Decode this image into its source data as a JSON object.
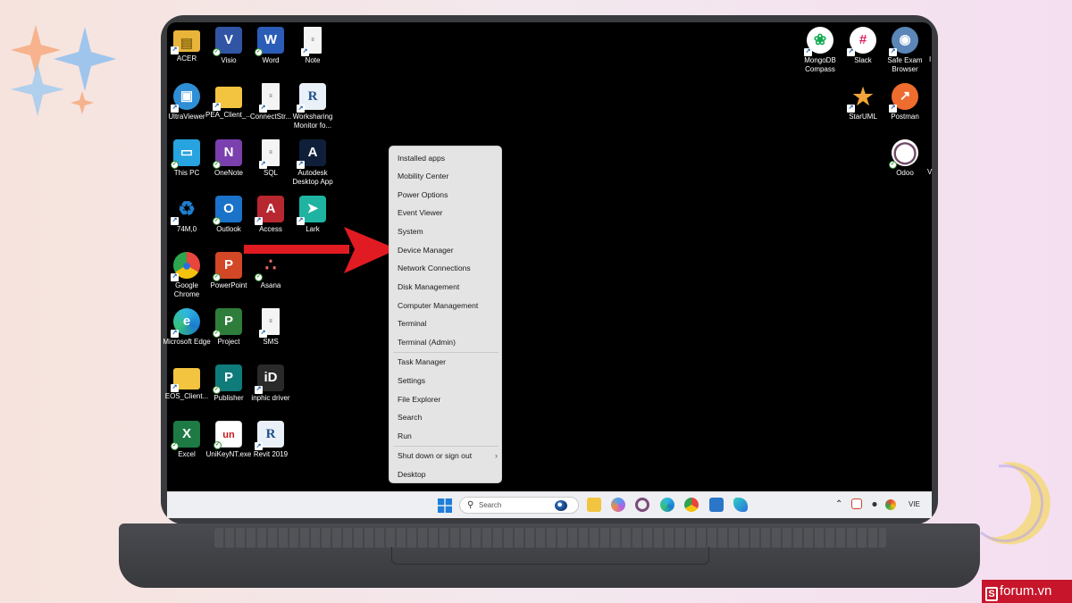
{
  "desktop": {
    "icons": [
      {
        "label": "ACER",
        "color": "#e8b43a",
        "glyph": "▤",
        "kind": "folder"
      },
      {
        "label": "Visio",
        "color": "#3155a4",
        "glyph": "V"
      },
      {
        "label": "Word",
        "color": "#2b5db8",
        "glyph": "W"
      },
      {
        "label": "Note",
        "color": "#f4f4f4",
        "glyph": "≡",
        "kind": "doc"
      },
      {
        "label": "UltraViewer",
        "color": "#2f8fd6",
        "glyph": "▣"
      },
      {
        "label": "PEA_Client_...",
        "color": "#f2c43f",
        "glyph": "",
        "kind": "folder"
      },
      {
        "label": "ConnectStr...",
        "color": "#f4f4f4",
        "glyph": "≡",
        "kind": "doc"
      },
      {
        "label": "Worksharing Monitor fo...",
        "color": "#eaf0f7",
        "glyph": "R",
        "kind": "revit"
      },
      {
        "label": "This PC",
        "color": "#27a3e0",
        "glyph": "▭"
      },
      {
        "label": "OneNote",
        "color": "#7b3fae",
        "glyph": "N"
      },
      {
        "label": "SQL",
        "color": "#f4f4f4",
        "glyph": "≡",
        "kind": "doc"
      },
      {
        "label": "Autodesk Desktop App",
        "color": "#0f1f3a",
        "glyph": "A"
      },
      {
        "label": "74M,0",
        "color": "#dfe8f0",
        "glyph": "♻",
        "kind": "bin"
      },
      {
        "label": "Outlook",
        "color": "#1a73c8",
        "glyph": "O"
      },
      {
        "label": "Access",
        "color": "#b7272f",
        "glyph": "A"
      },
      {
        "label": "Lark",
        "color": "#1fb3a2",
        "glyph": "➤"
      },
      {
        "label": "Google Chrome",
        "color": "#e6b321",
        "glyph": "●",
        "kind": "chrome"
      },
      {
        "label": "PowerPoint",
        "color": "#d24726",
        "glyph": "P"
      },
      {
        "label": "Asana",
        "color": "#f1f1f1",
        "glyph": "∴",
        "kind": "asana"
      },
      {
        "label": "Microsoft Edge",
        "color": "#1b84d0",
        "glyph": "e",
        "kind": "edge"
      },
      {
        "label": "Project",
        "color": "#2f7d3a",
        "glyph": "P"
      },
      {
        "label": "SMS",
        "color": "#f4f4f4",
        "glyph": "≡",
        "kind": "doc"
      },
      {
        "label": "EOS_Client...",
        "color": "#f2c43f",
        "glyph": "",
        "kind": "folder"
      },
      {
        "label": "Publisher",
        "color": "#0f7b7b",
        "glyph": "P"
      },
      {
        "label": "inphic driver",
        "color": "#2a2a2a",
        "glyph": "iD"
      },
      {
        "label": "Excel",
        "color": "#1d7a45",
        "glyph": "X"
      },
      {
        "label": "UniKeyNT.exe",
        "color": "#ffffff",
        "glyph": "un",
        "kind": "unikey"
      },
      {
        "label": "Revit 2019",
        "color": "#eaf0f7",
        "glyph": "R",
        "kind": "revit"
      },
      {
        "label": "MongoDB Compass",
        "color": "#ffffff",
        "glyph": "❀",
        "kind": "mongo"
      },
      {
        "label": "Slack",
        "color": "#ffffff",
        "glyph": "#",
        "kind": "slack"
      },
      {
        "label": "Safe Exam Browser",
        "color": "#5a86b8",
        "glyph": "◉"
      },
      {
        "label": "StarUML",
        "color": "#ffffff",
        "glyph": "★",
        "kind": "staruml"
      },
      {
        "label": "Postman",
        "color": "#ef6c2f",
        "glyph": "↗"
      },
      {
        "label": "Odoo",
        "color": "#ffffff",
        "glyph": "◯",
        "kind": "odoo"
      }
    ]
  },
  "context_menu": {
    "items": [
      "Installed apps",
      "Mobility Center",
      "Power Options",
      "Event Viewer",
      "System",
      "Device Manager",
      "Network Connections",
      "Disk Management",
      "Computer Management",
      "Terminal",
      "Terminal (Admin)",
      "Task Manager",
      "Settings",
      "File Explorer",
      "Search",
      "Run",
      "Shut down or sign out",
      "Desktop"
    ],
    "submenu_arrow": "›"
  },
  "taskbar": {
    "search_placeholder": "Search",
    "tray_language": "VIE",
    "tray_chevron": "⌃"
  },
  "partial_right_icons": [
    "I",
    "V"
  ],
  "brand": {
    "letter": "S",
    "text": "forum.vn",
    "color": "#c7162b"
  },
  "colors": {
    "arrow": "#e11b22",
    "menu_bg": "#e4e4e4",
    "screen": "#000000"
  }
}
